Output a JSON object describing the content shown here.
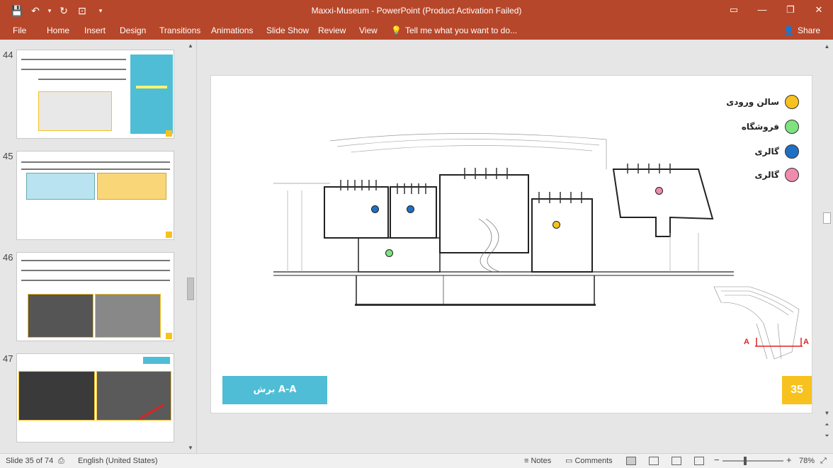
{
  "window": {
    "title": "Maxxi-Museum - PowerPoint (Product Activation Failed)",
    "controls": [
      "▭",
      "—",
      "❐",
      "✕"
    ]
  },
  "qat": {
    "save": "💾",
    "undo": "↶",
    "undo_drop": "▾",
    "redo": "↻",
    "present": "⊡",
    "customize": "▾"
  },
  "ribbon": {
    "tabs": [
      "File",
      "Home",
      "Insert",
      "Design",
      "Transitions",
      "Animations",
      "Slide Show",
      "Review",
      "View"
    ],
    "tell_me": "Tell me what you want to do...",
    "share": "Share"
  },
  "thumbnails": [
    {
      "number": "44"
    },
    {
      "number": "45"
    },
    {
      "number": "46"
    },
    {
      "number": "47"
    }
  ],
  "slide": {
    "legend": [
      {
        "label": "سالن ورودی",
        "color": "#f7c21e"
      },
      {
        "label": "فروشگاه",
        "color": "#7ee37e"
      },
      {
        "label": "گالری",
        "color": "#1f6fc4"
      },
      {
        "label": "گالری",
        "color": "#f08bb0"
      }
    ],
    "section_label": "برش A-A",
    "page_number": "35",
    "plan_marker_left": "A",
    "plan_marker_right": "A",
    "section_dots": [
      {
        "color": "#1f6fc4"
      },
      {
        "color": "#1f6fc4"
      },
      {
        "color": "#f7c21e"
      },
      {
        "color": "#7ee37e"
      },
      {
        "color": "#f08bb0"
      }
    ]
  },
  "status": {
    "slide_info": "Slide 35 of 74",
    "language": "English (United States)",
    "notes": "Notes",
    "comments": "Comments",
    "zoom": "78%",
    "zoom_minus": "−",
    "zoom_plus": "+"
  }
}
